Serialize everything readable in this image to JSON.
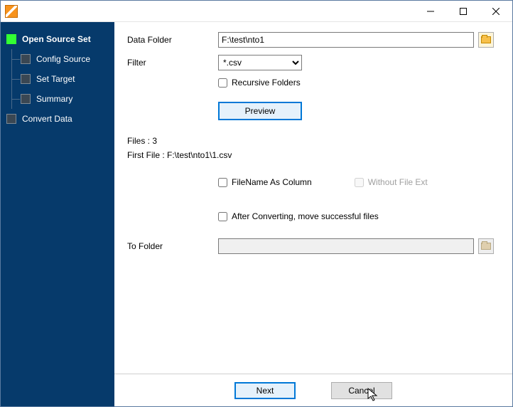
{
  "sidebar": {
    "items": [
      {
        "label": "Open Source Set",
        "active": true,
        "child": false
      },
      {
        "label": "Config Source",
        "active": false,
        "child": true
      },
      {
        "label": "Set Target",
        "active": false,
        "child": true
      },
      {
        "label": "Summary",
        "active": false,
        "child": true
      },
      {
        "label": "Convert Data",
        "active": false,
        "child": false
      }
    ]
  },
  "form": {
    "dataFolderLabel": "Data Folder",
    "dataFolderValue": "F:\\test\\nto1",
    "filterLabel": "Filter",
    "filterValue": "*.csv",
    "recursiveLabel": "Recursive Folders",
    "previewLabel": "Preview",
    "filesLine": "Files : 3",
    "firstFileLine": "First File : F:\\test\\nto1\\1.csv",
    "filenameAsColLabel": "FileName As Column",
    "withoutExtLabel": "Without File Ext",
    "afterConvertLabel": "After Converting, move successful files",
    "toFolderLabel": "To Folder",
    "toFolderValue": ""
  },
  "footer": {
    "nextLabel": "Next",
    "cancelLabel": "Cancel"
  }
}
